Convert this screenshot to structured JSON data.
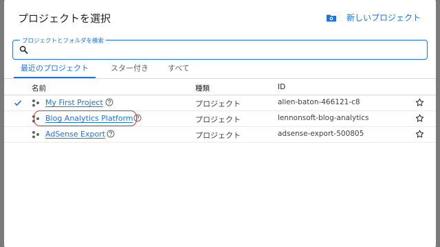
{
  "dialog": {
    "title": "プロジェクトを選択",
    "new_project_label": "新しいプロジェクト"
  },
  "search": {
    "label": "プロジェクトとフォルダを検索",
    "value": "",
    "placeholder": ""
  },
  "tabs": [
    {
      "label": "最近のプロジェクト",
      "active": true
    },
    {
      "label": "スター付き",
      "active": false
    },
    {
      "label": "すべて",
      "active": false
    }
  ],
  "table": {
    "headers": {
      "name": "名前",
      "type": "種類",
      "id": "ID"
    },
    "rows": [
      {
        "selected": true,
        "name": "My First Project",
        "type": "プロジェクト",
        "id": "alien-baton-466121-c8",
        "highlighted": false
      },
      {
        "selected": false,
        "name": "Blog Analytics Platform",
        "type": "プロジェクト",
        "id": "lennonsoft-blog-analytics",
        "highlighted": true
      },
      {
        "selected": false,
        "name": "AdSense Export",
        "type": "プロジェクト",
        "id": "adsense-export-500805",
        "highlighted": false
      }
    ]
  },
  "colors": {
    "accent": "#1a73e8",
    "highlight": "#d93025",
    "overlay": "#8a8a8a"
  },
  "icons": {
    "new_project": "folder-add-icon",
    "search": "search-icon",
    "selected": "check-icon",
    "project": "project-hub-icon",
    "help": "help-circle-icon",
    "star": "star-outline-icon"
  }
}
